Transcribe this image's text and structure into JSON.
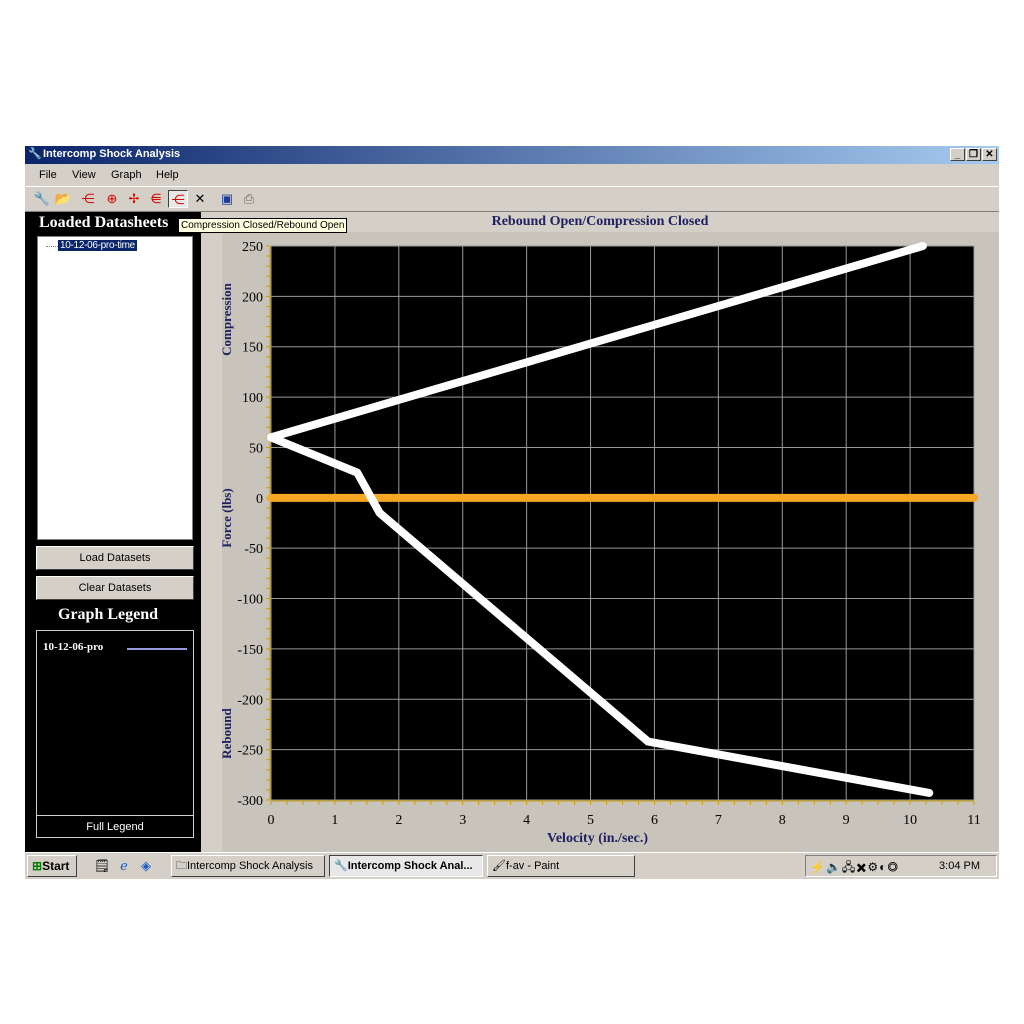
{
  "window": {
    "title": "Intercomp Shock Analysis",
    "app_icon": "wrench-icon"
  },
  "menu": [
    "File",
    "View",
    "Graph",
    "Help"
  ],
  "toolbar": {
    "tooltip": "Compression Closed/Rebound Open",
    "tools": [
      "wrench-icon",
      "open-folder-icon",
      "graph-compression-icon",
      "graph-both-icon",
      "graph-rebound-icon",
      "graph-open-icon",
      "graph-closed-icon",
      "clear-icon",
      "save-icon",
      "print-icon"
    ]
  },
  "left_panel": {
    "loaded_heading": "Loaded Datasheets",
    "datasets": [
      "10-12-06-pro-time"
    ],
    "load_button": "Load Datasets",
    "clear_button": "Clear Datasets",
    "legend_heading": "Graph Legend",
    "legend_items": [
      {
        "label": "10-12-06-pro",
        "color": "#9999dd"
      }
    ],
    "full_legend": "Full Legend"
  },
  "chart_data": {
    "type": "line",
    "title": "Rebound Open/Compression Closed",
    "xlabel": "Velocity (in./sec.)",
    "ylabel": "Force (lbs)",
    "ylabel_top": "Compression",
    "ylabel_bottom": "Rebound",
    "xlim": [
      0,
      11
    ],
    "ylim": [
      -300,
      250
    ],
    "xticks": [
      0,
      1,
      2,
      3,
      4,
      5,
      6,
      7,
      8,
      9,
      10,
      11
    ],
    "yticks": [
      250,
      200,
      150,
      100,
      50,
      0,
      -50,
      -100,
      -150,
      -200,
      -250,
      -300
    ],
    "grid": true,
    "background": "#000000",
    "series": [
      {
        "color": "#ffffff",
        "x": [
          0,
          10.2
        ],
        "y": [
          60,
          250
        ]
      },
      {
        "color": "#ffffff",
        "x": [
          0,
          1.35,
          1.7,
          5.9,
          10.3
        ],
        "y": [
          60,
          25,
          -15,
          -242,
          -293
        ]
      }
    ],
    "reference_line": {
      "y": 0,
      "color": "#f5a623"
    }
  },
  "taskbar": {
    "start": "Start",
    "quick_launch": [
      "desktop-icon",
      "ie-icon",
      "media-icon"
    ],
    "tasks": [
      {
        "label": "Intercomp Shock Analysis",
        "icon": "folder-icon",
        "active": false
      },
      {
        "label": "Intercomp Shock Anal...",
        "icon": "wrench-icon",
        "active": true
      },
      {
        "label": "f-av - Paint",
        "icon": "paint-icon",
        "active": false
      }
    ],
    "clock": "3:04 PM"
  }
}
